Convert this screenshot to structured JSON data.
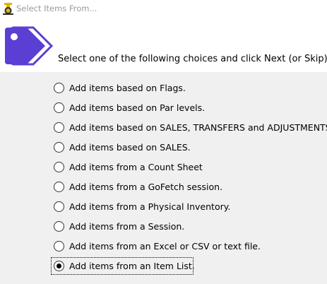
{
  "window": {
    "title": "Select Items From..."
  },
  "header": {
    "logo_icon": "price-tag-icon",
    "instruction": "Select one of the following choices and click Next (or Skip)"
  },
  "colors": {
    "tag_primary": "#5b3fd4",
    "header_background": "#ffffff",
    "body_background": "#f0f0f0",
    "title_text": "#9a9a9a"
  },
  "options": [
    {
      "label": "Add items based on Flags.",
      "selected": false
    },
    {
      "label": "Add items based on Par levels.",
      "selected": false
    },
    {
      "label": "Add items based on SALES, TRANSFERS and ADJUSTMENTS.",
      "selected": false
    },
    {
      "label": "Add items based on SALES.",
      "selected": false
    },
    {
      "label": "Add items from a Count Sheet",
      "selected": false
    },
    {
      "label": "Add items from a GoFetch session.",
      "selected": false
    },
    {
      "label": "Add items from a Physical Inventory.",
      "selected": false
    },
    {
      "label": "Add items from a Session.",
      "selected": false
    },
    {
      "label": "Add items from an Excel or CSV or text file.",
      "selected": false
    },
    {
      "label": "Add items from an Item List.",
      "selected": true
    }
  ]
}
